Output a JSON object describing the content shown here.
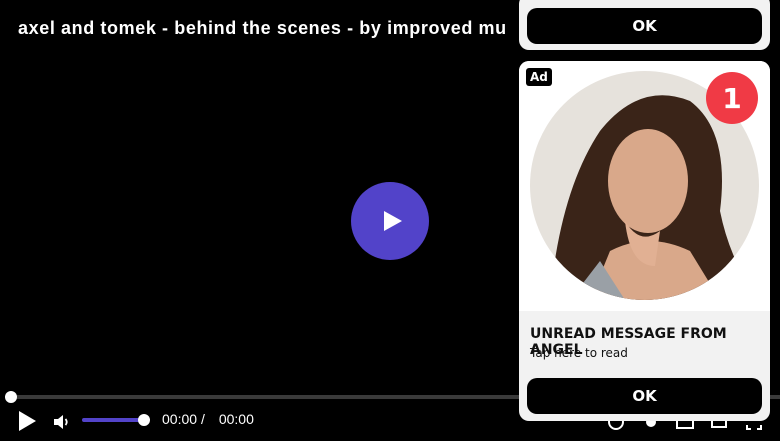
{
  "video": {
    "title": "axel and tomek - behind the scenes - by improved mu",
    "current_time": "00:00",
    "separator": "/",
    "duration": "00:00",
    "volume_level": 0.9,
    "progress": 0,
    "accent_color": "#5243c9"
  },
  "ad_top": {
    "ok_label": "OK"
  },
  "ad_card": {
    "badge": "Ad",
    "notification_count": "1",
    "headline": "UNREAD MESSAGE FROM ANGEL",
    "subtext": "Tap here to read",
    "ok_label": "OK",
    "badge_color": "#f03a45"
  },
  "icons": [
    "play-icon",
    "volume-icon",
    "pip-icon",
    "settings-icon",
    "captions-icon",
    "cast-icon",
    "fullscreen-icon"
  ]
}
